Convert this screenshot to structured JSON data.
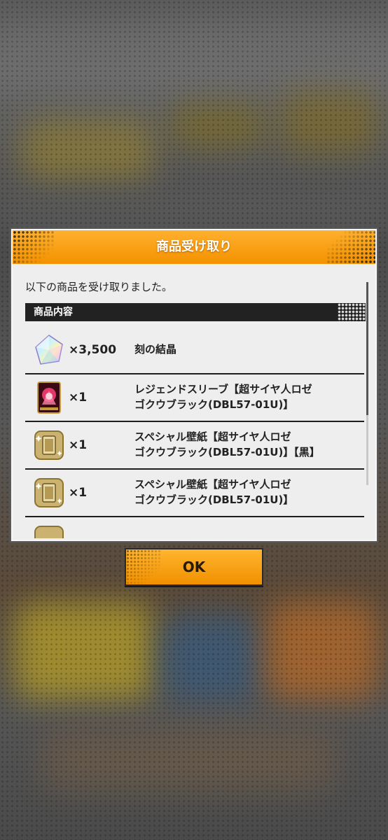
{
  "dialog": {
    "title": "商品受け取り",
    "message": "以下の商品を受け取りました。",
    "section_label": "商品内容",
    "items": [
      {
        "icon": "crystal-icon",
        "quantity": "×3,500",
        "name": "刻の結晶"
      },
      {
        "icon": "sleeve-icon",
        "quantity": "×1",
        "name": "レジェンドスリーブ【超サイヤ人ロゼ\nゴクウブラック(DBL57-01U)】"
      },
      {
        "icon": "wallpaper-icon",
        "quantity": "×1",
        "name": "スペシャル壁紙【超サイヤ人ロゼ\nゴクウブラック(DBL57-01U)】【黒】"
      },
      {
        "icon": "wallpaper-icon",
        "quantity": "×1",
        "name": "スペシャル壁紙【超サイヤ人ロゼ\nゴクウブラック(DBL57-01U)】"
      }
    ]
  },
  "ok_button": {
    "label": "OK"
  },
  "colors": {
    "accent": "#f39200",
    "dark": "#222222",
    "panel": "#eeeeee"
  }
}
